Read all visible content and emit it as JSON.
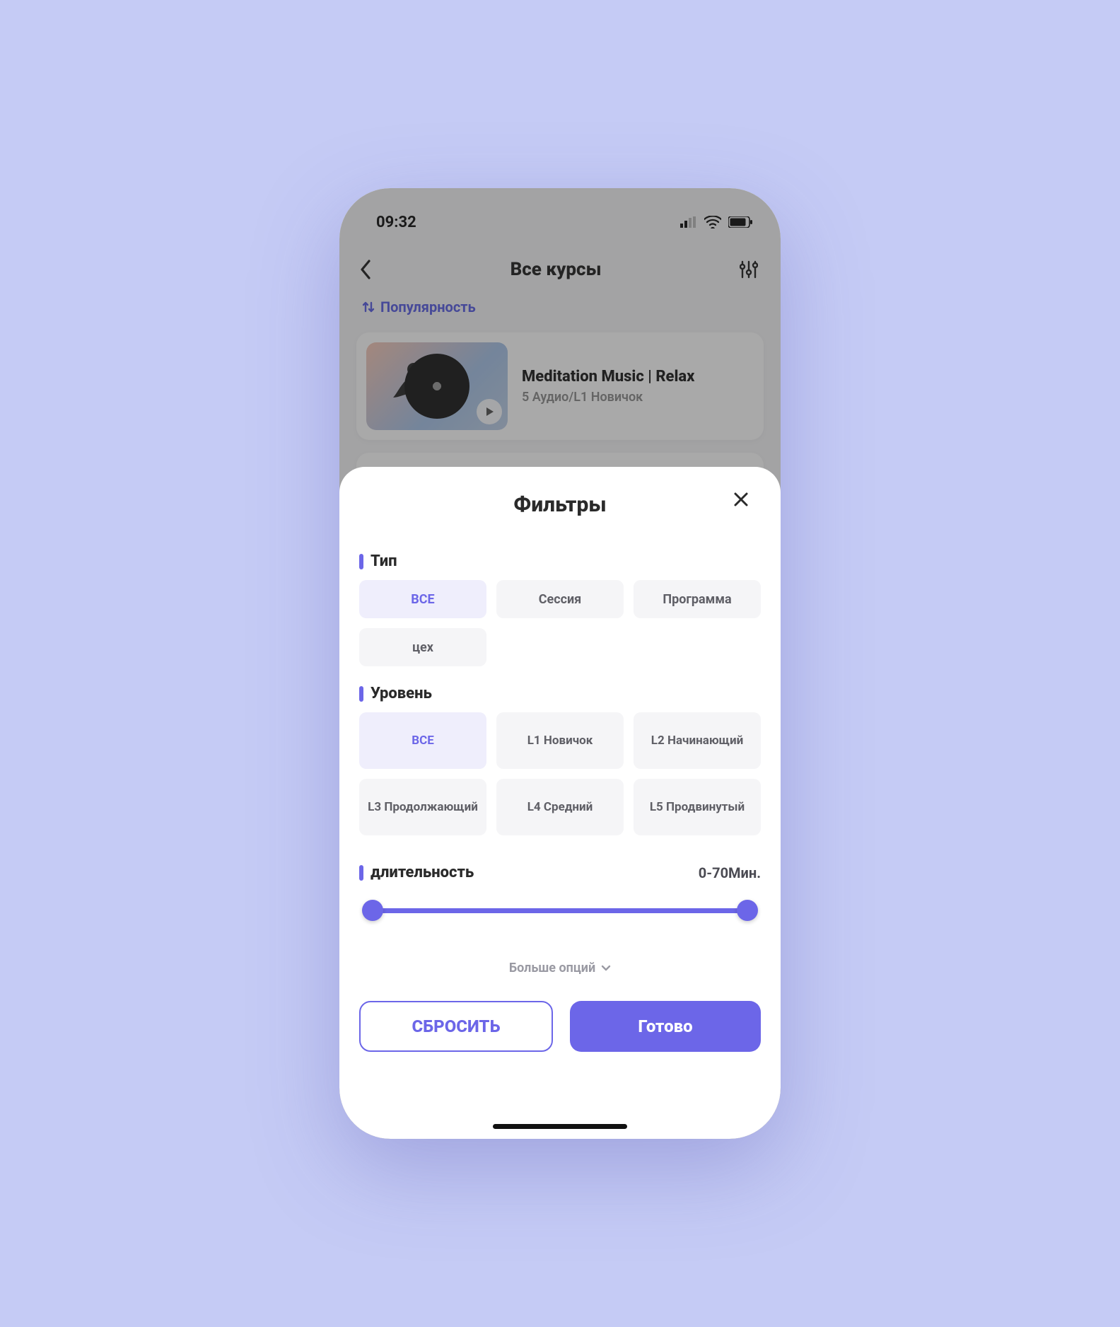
{
  "status": {
    "time": "09:32"
  },
  "nav": {
    "title": "Все курсы"
  },
  "sort": {
    "label": "Популярность"
  },
  "course": {
    "title": "Meditation Music | Relax",
    "subtitle": "5 Аудио/L1 Новичок"
  },
  "sheet": {
    "title": "Фильтры",
    "type_h": "Тип",
    "type_opts": [
      "ВСЕ",
      "Сессия",
      "Программа",
      "цех"
    ],
    "level_h": "Уровень",
    "level_opts": [
      "ВСЕ",
      "L1 Новичок",
      "L2 Начинающий",
      "L3 Продолжающий",
      "L4 Средний",
      "L5 Продвинутый"
    ],
    "duration_h": "длительность",
    "duration_val": "0-70Мин.",
    "more": "Больше опций",
    "reset": "СБРОСИТЬ",
    "done": "Готово"
  }
}
